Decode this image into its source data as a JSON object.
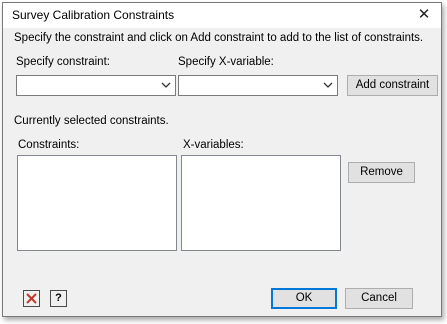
{
  "window": {
    "title": "Survey Calibration Constraints",
    "close_glyph": "✕"
  },
  "instructions": "Specify the constraint and click on Add constraint to add to the list of constraints.",
  "constraint_combo": {
    "label": "Specify constraint:",
    "value": ""
  },
  "xvariable_combo": {
    "label": "Specify X-variable:",
    "value": ""
  },
  "add_constraint_label": "Add constraint",
  "selected_label": "Currently selected constraints.",
  "constraints_list": {
    "label": "Constraints:",
    "items": []
  },
  "xvariables_list": {
    "label": "X-variables:",
    "items": []
  },
  "remove_label": "Remove",
  "footer": {
    "clear_icon_glyph": "✕",
    "help_icon_glyph": "?",
    "ok_label": "OK",
    "cancel_label": "Cancel"
  },
  "colors": {
    "clear_icon": "#c0392b",
    "focus_border": "#0078d7"
  }
}
